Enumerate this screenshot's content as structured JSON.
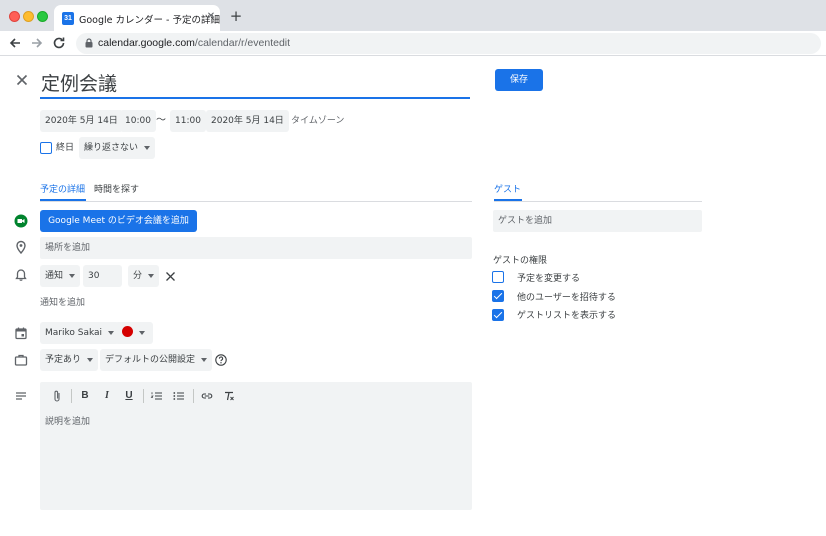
{
  "browser": {
    "tab_title": "Google カレンダー - 予定の詳細",
    "tab_favicon": "31",
    "url_host": "calendar.google.com",
    "url_path": "/calendar/r/eventedit",
    "icons": [
      "close-icon",
      "plus-icon",
      "back-arrow-icon",
      "forward-arrow-icon",
      "reload-icon",
      "lock-icon"
    ]
  },
  "event": {
    "title": "定例会議",
    "save_label": "保存",
    "start_date": "2020年 5月 14日",
    "start_time": "10:00",
    "separator": "〜",
    "end_time": "11:00",
    "end_date": "2020年 5月 14日",
    "timezone_label": "タイムゾーン",
    "allday_label": "終日",
    "allday_checked": false,
    "repeat_label": "繰り返さない"
  },
  "tabs": {
    "details": "予定の詳細",
    "find_time": "時間を探す",
    "guests": "ゲスト"
  },
  "details": {
    "meet_label": "Google Meet のビデオ会議を追加",
    "location_placeholder": "場所を追加",
    "notification_type": "通知",
    "notification_value": "30",
    "notification_unit": "分",
    "add_notification": "通知を追加",
    "calendar_owner": "Mariko Sakai",
    "event_color": "#d50000",
    "availability": "予定あり",
    "visibility": "デフォルトの公開設定",
    "description_placeholder": "説明を追加",
    "editor_tools": [
      "attachment-icon",
      "bold-icon",
      "italic-icon",
      "underline-icon",
      "numbered-list-icon",
      "bulleted-list-icon",
      "link-icon",
      "clear-format-icon"
    ],
    "editor_tool_glyphs": {
      "bold": "B",
      "italic": "I",
      "underline": "U"
    }
  },
  "guests": {
    "add_placeholder": "ゲストを追加",
    "permissions_title": "ゲストの権限",
    "permissions": [
      {
        "label": "予定を変更する",
        "checked": false
      },
      {
        "label": "他のユーザーを招待する",
        "checked": true
      },
      {
        "label": "ゲストリストを表示する",
        "checked": true
      }
    ]
  },
  "colors": {
    "accent": "#1a73e8",
    "field_bg": "#f1f3f4",
    "meet_icon": "#00832d"
  }
}
